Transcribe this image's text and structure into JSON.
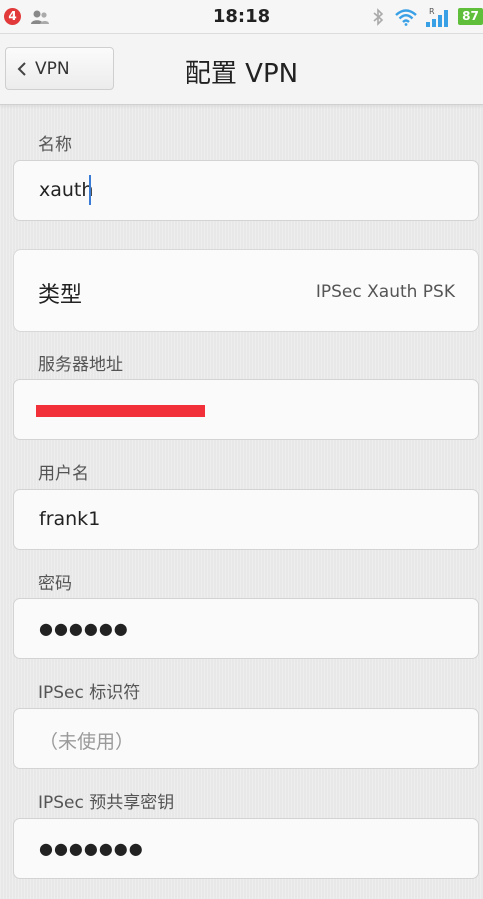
{
  "status_bar": {
    "notification_count": "4",
    "time": "18:18",
    "battery": "87",
    "signal_tag": "R"
  },
  "header": {
    "back_label": "VPN",
    "title": "配置 VPN"
  },
  "form": {
    "name": {
      "label": "名称",
      "value": "xauth"
    },
    "type": {
      "label": "类型",
      "value": "IPSec Xauth PSK"
    },
    "server": {
      "label": "服务器地址",
      "value": ""
    },
    "username": {
      "label": "用户名",
      "value": "frank1"
    },
    "password": {
      "label": "密码",
      "value": "●●●●●●"
    },
    "ipsec_id": {
      "label": "IPSec 标识符",
      "placeholder": "（未使用）"
    },
    "ipsec_psk": {
      "label": "IPSec 预共享密钥",
      "value": "●●●●●●●"
    }
  },
  "icons": {
    "contacts": "contacts-icon",
    "bluetooth": "bluetooth-icon",
    "wifi": "wifi-icon",
    "signal": "signal-icon",
    "back": "chevron-left-icon"
  },
  "colors": {
    "badge": "#e23a3a",
    "battery": "#5fbf3a",
    "wifi": "#3aa0e6",
    "signal": "#3aa0e6",
    "cursor": "#3a7bd5",
    "redaction": "#f2303a"
  }
}
